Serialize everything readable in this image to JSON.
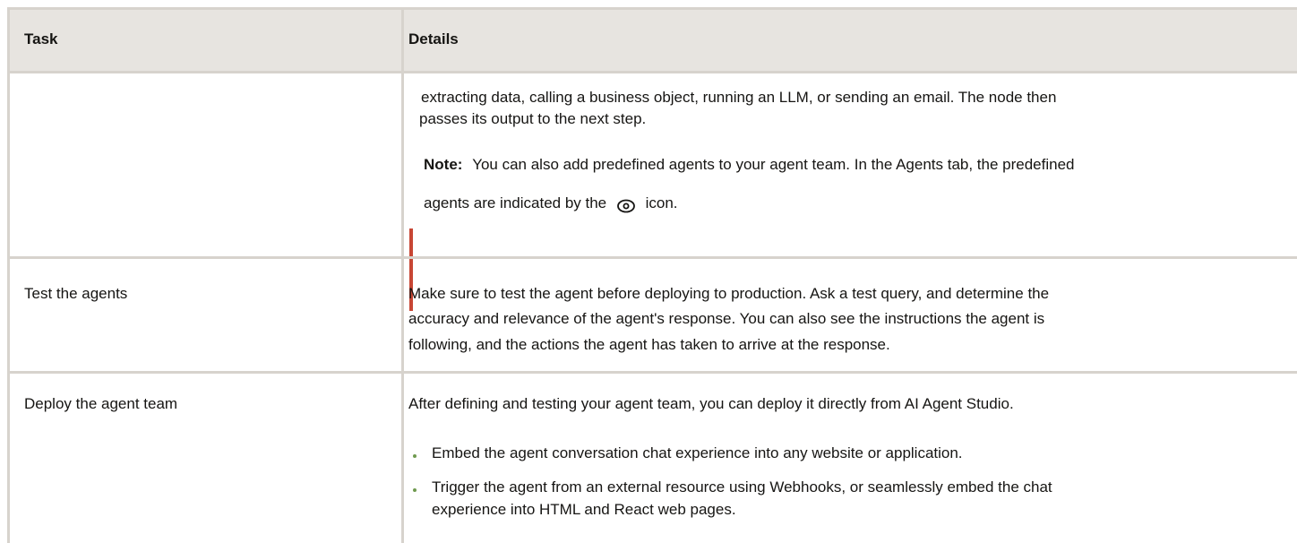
{
  "table": {
    "headers": {
      "task": "Task",
      "details": "Details"
    },
    "row1": {
      "details_line1": "extracting data, calling a business object, running an LLM, or sending an email. The node then",
      "details_line2": "passes its output to the next step.",
      "note_label": "Note:",
      "note_line1": "You can also add predefined agents to your agent team. In the Agents tab, the predefined",
      "note_line2_before": "agents are indicated by the",
      "note_line2_after": "icon.",
      "note_icon": "eye-icon"
    },
    "row2": {
      "task": "Test the agents",
      "details_line1": "Make sure to test the agent before deploying to production. Ask a test query, and determine the",
      "details_line2": "accuracy and relevance of the agent's response. You can also see the instructions the agent is",
      "details_line3": "following, and the actions the agent has taken to arrive at the response."
    },
    "row3": {
      "task": "Deploy the agent team",
      "details_intro": "After defining and testing your agent team, you can deploy it directly from AI Agent Studio.",
      "bullets": [
        {
          "line1": "Embed the agent conversation chat experience into any website or application."
        },
        {
          "line1": "Trigger the agent from an external resource using Webhooks, or seamlessly embed the chat",
          "line2": "experience into HTML and React web pages."
        }
      ]
    }
  },
  "colors": {
    "border": "#d7d3cd",
    "header_bg": "#e7e4e0",
    "note_accent": "#c74634",
    "bullet": "#6f9a4f",
    "text": "#161513"
  }
}
